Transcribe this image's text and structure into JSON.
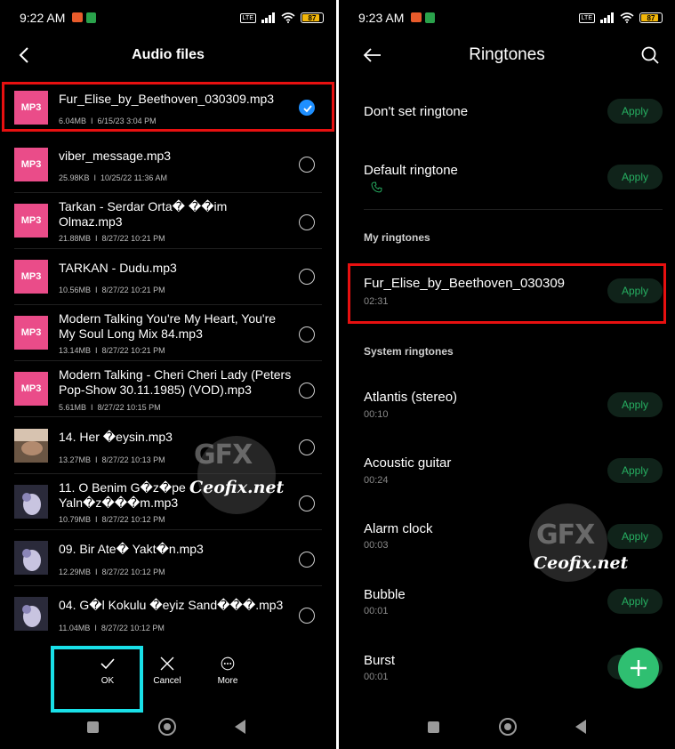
{
  "left": {
    "status": {
      "time": "9:22 AM",
      "battery": "87"
    },
    "title": "Audio files",
    "files": [
      {
        "thumb": "MP3",
        "name": "Fur_Elise_by_Beethoven_030309.mp3",
        "size": "6.04MB",
        "date": "6/15/23 3:04 PM",
        "checked": true
      },
      {
        "thumb": "MP3",
        "name": "viber_message.mp3",
        "size": "25.98KB",
        "date": "10/25/22 11:36 AM",
        "checked": false
      },
      {
        "thumb": "MP3",
        "name": "Tarkan - Serdar Orta�    ��im Olmaz.mp3",
        "size": "21.88MB",
        "date": "8/27/22 10:21 PM",
        "checked": false
      },
      {
        "thumb": "MP3",
        "name": "TARKAN - Dudu.mp3",
        "size": "10.56MB",
        "date": "8/27/22 10:21 PM",
        "checked": false
      },
      {
        "thumb": "MP3",
        "name": "Modern Talking You're My Heart, You're My Soul Long Mix 84.mp3",
        "size": "13.14MB",
        "date": "8/27/22 10:21 PM",
        "checked": false
      },
      {
        "thumb": "MP3",
        "name": "Modern Talking - Cheri Cheri Lady (Peters Pop-Show 30.11.1985) (VOD).mp3",
        "size": "5.61MB",
        "date": "8/27/22 10:15 PM",
        "checked": false
      },
      {
        "thumb": "img",
        "name": "14. Her �eysin.mp3",
        "size": "13.27MB",
        "date": "8/27/22 10:13 PM",
        "checked": false
      },
      {
        "thumb": "img",
        "name": "11. O Benim G�z�pe   Yaln�z���m.mp3",
        "size": "10.79MB",
        "date": "8/27/22 10:12 PM",
        "checked": false
      },
      {
        "thumb": "img",
        "name": "09. Bir Ate� Yakt�n.mp3",
        "size": "12.29MB",
        "date": "8/27/22 10:12 PM",
        "checked": false
      },
      {
        "thumb": "img",
        "name": "04. G�l Kokulu �eyiz Sand���.mp3",
        "size": "11.04MB",
        "date": "8/27/22 10:12 PM",
        "checked": false
      }
    ],
    "actions": {
      "ok": "OK",
      "cancel": "Cancel",
      "more": "More"
    }
  },
  "right": {
    "status": {
      "time": "9:23 AM",
      "battery": "87"
    },
    "title": "Ringtones",
    "top_items": [
      {
        "name": "Don't set ringtone",
        "apply": "Apply"
      },
      {
        "name": "Default ringtone",
        "apply": "Apply"
      }
    ],
    "my_ringtones_header": "My ringtones",
    "my_ringtones": [
      {
        "name": "Fur_Elise_by_Beethoven_030309",
        "duration": "02:31",
        "apply": "Apply"
      }
    ],
    "system_ringtones_header": "System ringtones",
    "system_ringtones": [
      {
        "name": "Atlantis (stereo)",
        "duration": "00:10",
        "apply": "Apply"
      },
      {
        "name": "Acoustic guitar",
        "duration": "00:24",
        "apply": "Apply"
      },
      {
        "name": "Alarm clock",
        "duration": "00:03",
        "apply": "Apply"
      },
      {
        "name": "Bubble",
        "duration": "00:01",
        "apply": "Apply"
      },
      {
        "name": "Burst",
        "duration": "00:01",
        "apply": ""
      }
    ]
  },
  "watermark": {
    "logo": "GFX",
    "text": "Ceofix.net"
  },
  "colors": {
    "mp3_thumb": "#ea4c89",
    "check_blue": "#1e8fff",
    "apply_green": "#27b062",
    "fab_green": "#2fbf71",
    "highlight_red": "#e81010",
    "highlight_cyan": "#19e0e8"
  }
}
